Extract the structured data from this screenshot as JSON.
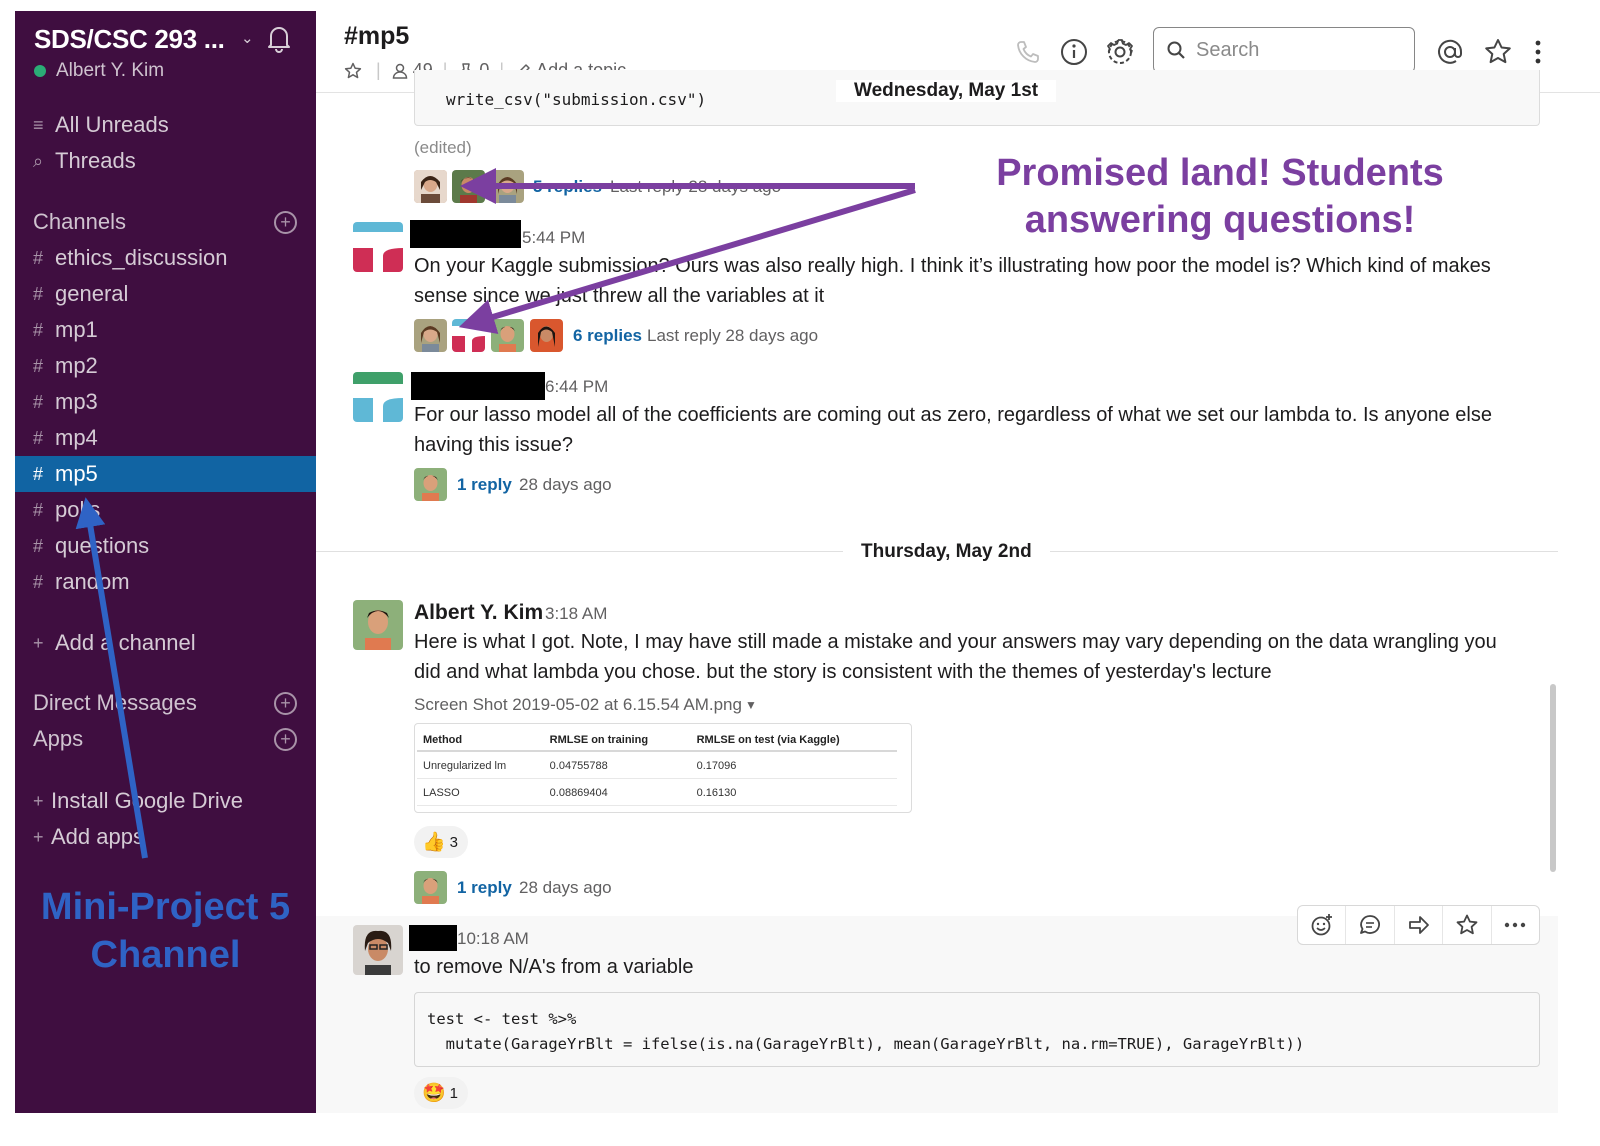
{
  "workspace": {
    "name": "SDS/CSC 293 ...",
    "user": "Albert Y. Kim"
  },
  "sidebar": {
    "top_items": [
      {
        "label": "All Unreads",
        "icon": "unreads-icon"
      },
      {
        "label": "Threads",
        "icon": "threads-icon"
      }
    ],
    "channels_header": "Channels",
    "channels": [
      "ethics_discussion",
      "general",
      "mp1",
      "mp2",
      "mp3",
      "mp4",
      "mp5",
      "polls",
      "questions",
      "random"
    ],
    "active_channel": "mp5",
    "add_channel": "Add a channel",
    "dm_header": "Direct Messages",
    "apps_header": "Apps",
    "install_drive": "Install Google Drive",
    "add_apps": "Add apps",
    "annotation": "Mini-Project 5 Channel"
  },
  "header": {
    "channel": "#mp5",
    "members": "49",
    "pinned": "0",
    "topic_placeholder": "Add a topic",
    "search_placeholder": "Search"
  },
  "messages": {
    "code_top": "write_csv(\"submission.csv\")",
    "date1": "Wednesday, May 1st",
    "edited": "(edited)",
    "thread0": {
      "replies": "5 replies",
      "meta": "Last reply 28 days ago"
    },
    "m1": {
      "time": "5:44 PM",
      "text": "On your Kaggle submission? Ours was also really high. I think it’s illustrating how poor the model is? Which kind of makes sense since we just threw all the variables at it",
      "replies": "6 replies",
      "meta": "Last reply 28 days ago"
    },
    "m2": {
      "time": "6:44 PM",
      "text": "For our lasso model all of the coefficients are coming out as zero, regardless of what we set our lambda to. Is anyone else having this issue?",
      "replies": "1 reply",
      "meta": "28 days ago"
    },
    "date2": "Thursday, May 2nd",
    "m3": {
      "sender": "Albert Y. Kim",
      "time": "3:18 AM",
      "text": "Here is what I got. Note, I may have still made a mistake and your answers may vary depending on the data wrangling you did and what lambda you chose. but the story is consistent with the themes of yesterday's lecture",
      "file_name": "Screen Shot 2019-05-02 at 6.15.54 AM.png",
      "table": {
        "headers": [
          "Method",
          "RMLSE on training",
          "RMLSE on test (via Kaggle)"
        ],
        "rows": [
          [
            "Unregularized lm",
            "0.04755788",
            "0.17096"
          ],
          [
            "LASSO",
            "0.08869404",
            "0.16130"
          ]
        ]
      },
      "reaction": {
        "emoji": "👍",
        "count": "3"
      },
      "replies": "1 reply",
      "meta": "28 days ago"
    },
    "m4": {
      "time": "10:18 AM",
      "text": "to remove N/A's from a variable",
      "code_line1": "test <- test %>%",
      "code_line2": "  mutate(GarageYrBlt = ifelse(is.na(GarageYrBlt), mean(GarageYrBlt, na.rm=TRUE), GarageYrBlt))",
      "reaction": {
        "emoji": "🤩",
        "count": "1"
      }
    }
  },
  "annotation": {
    "line1": "Promised land! Students",
    "line2": "answering questions!"
  },
  "colors": {
    "sidebar_bg": "#3f0e40",
    "active_channel_bg": "#1164a3",
    "link_blue": "#1264a3",
    "annotation_purple": "#7b3fa0",
    "annotation_blue": "#2f63c5"
  }
}
